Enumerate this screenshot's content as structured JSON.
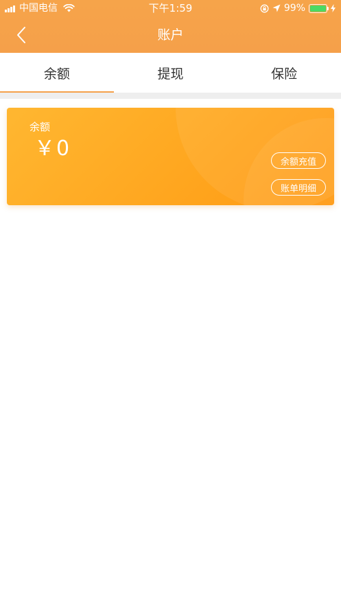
{
  "status_bar": {
    "carrier": "中国电信",
    "time": "下午1:59",
    "battery_percent": "99%",
    "battery_color": "#4cd964"
  },
  "nav": {
    "title": "账户",
    "back_icon": "chevron-left-icon"
  },
  "tabs": [
    {
      "label": "余额",
      "active": true
    },
    {
      "label": "提现",
      "active": false
    },
    {
      "label": "保险",
      "active": false
    }
  ],
  "card": {
    "label": "余额",
    "amount": "￥0",
    "recharge_label": "余额充值",
    "bill_label": "账单明细"
  },
  "colors": {
    "header": "#f5a04a",
    "card_start": "#ffb731",
    "card_end": "#ff9a12",
    "tab_indicator": "#f5a04a"
  }
}
